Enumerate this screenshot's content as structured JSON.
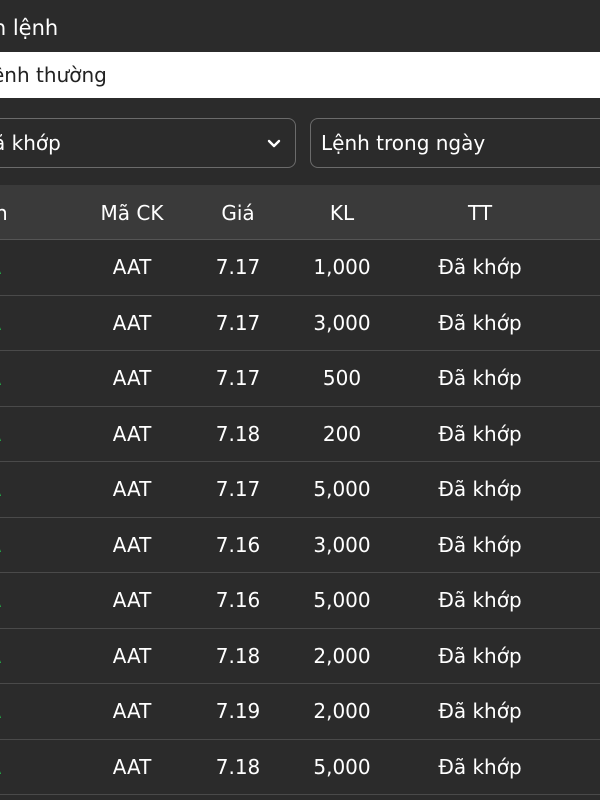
{
  "panel": {
    "title": "ọn lệnh",
    "order_type": "ệnh thường"
  },
  "filters": {
    "status": "ã khớp",
    "scope": "Lệnh trong ngày"
  },
  "table": {
    "headers": {
      "side": "ệnh",
      "code": "Mã CK",
      "price": "Giá",
      "qty": "KL",
      "status": "TT"
    },
    "rows": [
      {
        "side": "UA",
        "code": "AAT",
        "price": "7.17",
        "qty": "1,000",
        "status": "Đã khớp"
      },
      {
        "side": "UA",
        "code": "AAT",
        "price": "7.17",
        "qty": "3,000",
        "status": "Đã khớp"
      },
      {
        "side": "UA",
        "code": "AAT",
        "price": "7.17",
        "qty": "500",
        "status": "Đã khớp"
      },
      {
        "side": "UA",
        "code": "AAT",
        "price": "7.18",
        "qty": "200",
        "status": "Đã khớp"
      },
      {
        "side": "UA",
        "code": "AAT",
        "price": "7.17",
        "qty": "5,000",
        "status": "Đã khớp"
      },
      {
        "side": "UA",
        "code": "AAT",
        "price": "7.16",
        "qty": "3,000",
        "status": "Đã khớp"
      },
      {
        "side": "UA",
        "code": "AAT",
        "price": "7.16",
        "qty": "5,000",
        "status": "Đã khớp"
      },
      {
        "side": "UA",
        "code": "AAT",
        "price": "7.18",
        "qty": "2,000",
        "status": "Đã khớp"
      },
      {
        "side": "UA",
        "code": "AAT",
        "price": "7.19",
        "qty": "2,000",
        "status": "Đã khớp"
      },
      {
        "side": "UA",
        "code": "AAT",
        "price": "7.18",
        "qty": "5,000",
        "status": "Đã khớp"
      }
    ]
  },
  "colors": {
    "background": "#2b2b2b",
    "header_bg": "#3a3a3a",
    "buy": "#22b84a",
    "text": "#ffffff"
  },
  "icons": {
    "status_dropdown": "chevron-down-icon"
  }
}
